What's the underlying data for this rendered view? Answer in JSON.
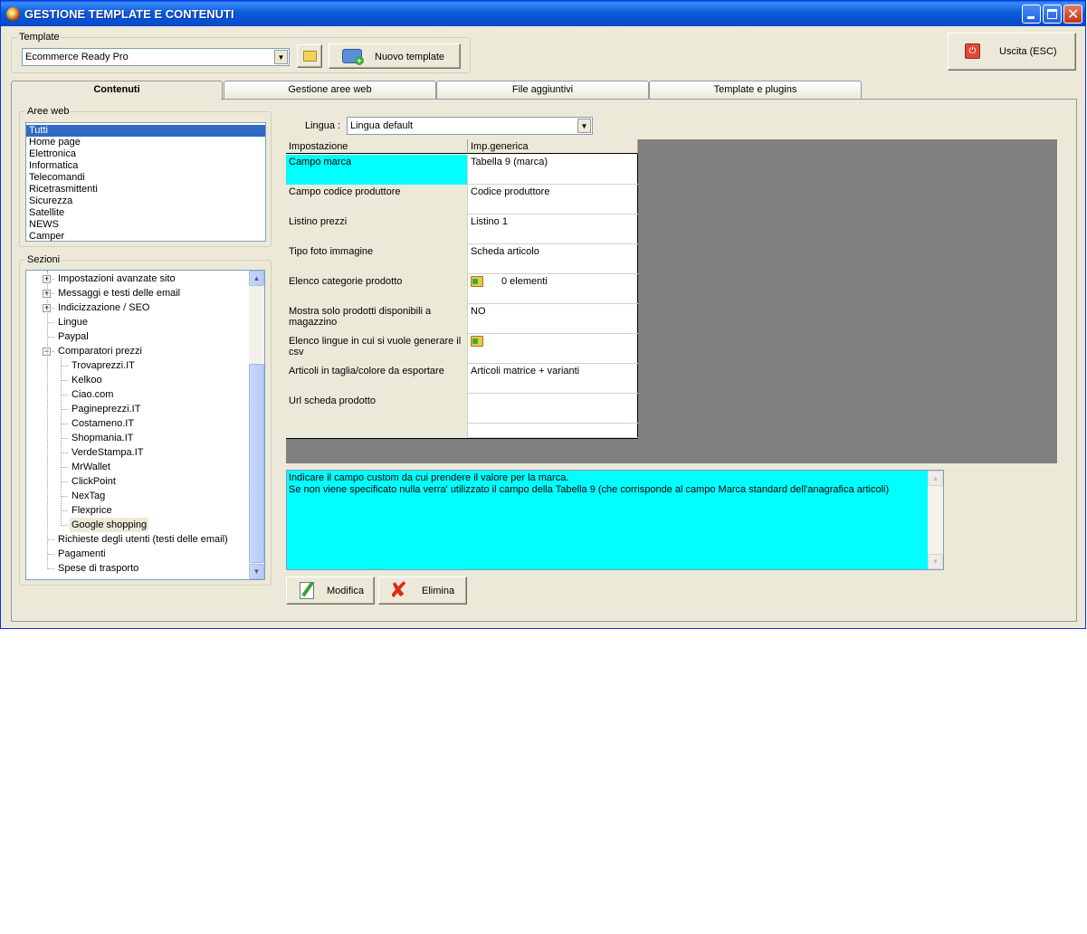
{
  "window": {
    "title": "GESTIONE TEMPLATE E CONTENUTI"
  },
  "template_group": {
    "legend": "Template",
    "selected": "Ecommerce Ready Pro",
    "new_button": "Nuovo template"
  },
  "exit_button": "Uscita (ESC)",
  "tabs": [
    {
      "label": "Contenuti",
      "active": true
    },
    {
      "label": "Gestione aree web",
      "active": false
    },
    {
      "label": "File aggiuntivi",
      "active": false
    },
    {
      "label": "Template e plugins",
      "active": false
    }
  ],
  "aree_web": {
    "legend": "Aree web",
    "items": [
      "Tutti",
      "Home page",
      "Elettronica",
      "Informatica",
      "Telecomandi",
      "Ricetrasmittenti",
      "Sicurezza",
      "Satellite",
      "NEWS",
      "Camper"
    ]
  },
  "sezioni": {
    "legend": "Sezioni",
    "nodes": [
      {
        "label": "Impostazioni avanzate sito",
        "level": 1,
        "expander": "+"
      },
      {
        "label": "Messaggi e testi delle email",
        "level": 1,
        "expander": "+"
      },
      {
        "label": "Indicizzazione / SEO",
        "level": 1,
        "expander": "+"
      },
      {
        "label": "Lingue",
        "level": 1,
        "expander": ""
      },
      {
        "label": "Paypal",
        "level": 1,
        "expander": ""
      },
      {
        "label": "Comparatori prezzi",
        "level": 1,
        "expander": "-"
      },
      {
        "label": "Trovaprezzi.IT",
        "level": 2,
        "expander": ""
      },
      {
        "label": "Kelkoo",
        "level": 2,
        "expander": ""
      },
      {
        "label": "Ciao.com",
        "level": 2,
        "expander": ""
      },
      {
        "label": "Pagineprezzi.IT",
        "level": 2,
        "expander": ""
      },
      {
        "label": "Costameno.IT",
        "level": 2,
        "expander": ""
      },
      {
        "label": "Shopmania.IT",
        "level": 2,
        "expander": ""
      },
      {
        "label": "VerdeStampa.IT",
        "level": 2,
        "expander": ""
      },
      {
        "label": "MrWallet",
        "level": 2,
        "expander": ""
      },
      {
        "label": "ClickPoint",
        "level": 2,
        "expander": ""
      },
      {
        "label": "NexTag",
        "level": 2,
        "expander": ""
      },
      {
        "label": "Flexprice",
        "level": 2,
        "expander": ""
      },
      {
        "label": "Google shopping",
        "level": 2,
        "expander": "",
        "selected": true
      },
      {
        "label": "Richieste degli utenti (testi delle email)",
        "level": 1,
        "expander": ""
      },
      {
        "label": "Pagamenti",
        "level": 1,
        "expander": ""
      },
      {
        "label": "Spese di trasporto",
        "level": 1,
        "expander": ""
      }
    ]
  },
  "lingua": {
    "label": "Lingua :",
    "selected": "Lingua default"
  },
  "grid": {
    "headers": [
      "Impostazione",
      "Imp.generica"
    ],
    "rows": [
      {
        "name": "Campo marca",
        "value": "Tabella 9 (marca)",
        "icon": false,
        "highlight": true
      },
      {
        "name": "Campo codice produttore",
        "value": "Codice produttore",
        "icon": false
      },
      {
        "name": "Listino prezzi",
        "value": "Listino 1",
        "icon": false
      },
      {
        "name": "Tipo foto immagine",
        "value": "Scheda articolo",
        "icon": false
      },
      {
        "name": "Elenco categorie prodotto",
        "value": "0 elementi",
        "icon": true
      },
      {
        "name": "Mostra solo prodotti disponibili a magazzino",
        "value": "NO",
        "icon": false
      },
      {
        "name": "Elenco lingue in cui si vuole generare il csv",
        "value": "",
        "icon": true
      },
      {
        "name": "Articoli in taglia/colore da esportare",
        "value": "Articoli matrice + varianti",
        "icon": false
      },
      {
        "name": "Url scheda prodotto",
        "value": "",
        "icon": false
      }
    ]
  },
  "description": {
    "line1": "Indicare il campo custom da cui prendere il valore per la marca.",
    "line2": "Se non viene specificato nulla verra' utilizzato il campo della Tabella 9 (che corrisponde al campo Marca standard dell'anagrafica articoli)"
  },
  "actions": {
    "modify": "Modifica",
    "delete": "Elimina"
  }
}
